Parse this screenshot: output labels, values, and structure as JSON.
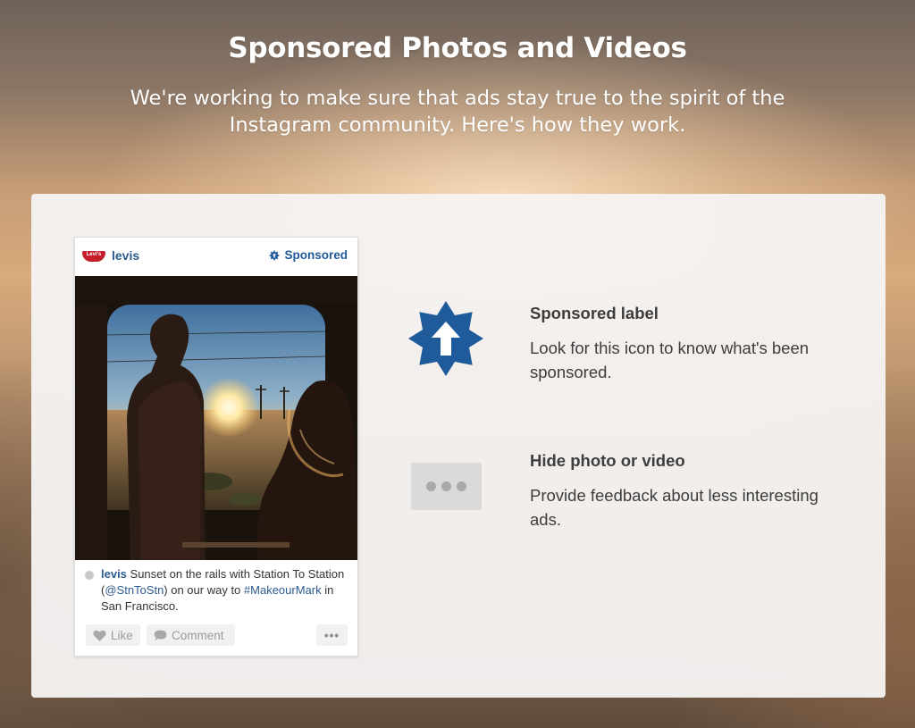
{
  "header": {
    "title": "Sponsored Photos and Videos",
    "subtitle": "We're working to make sure that ads stay true to the spirit of the Instagram community. Here's how they work."
  },
  "post": {
    "logo_text": "Levi's",
    "username": "levis",
    "sponsored_label": "Sponsored",
    "caption": {
      "user": "levis",
      "text_1": " Sunset on the rails with Station To Station (",
      "mention": "@StnToStn",
      "text_2": ") on our way to ",
      "hashtag": "#MakeourMark",
      "text_3": " in San Francisco."
    },
    "like_label": "Like",
    "comment_label": "Comment",
    "more_label": "•••"
  },
  "features": {
    "sponsored": {
      "title": "Sponsored label",
      "description": "Look for this icon to know what's been sponsored."
    },
    "hide": {
      "title": "Hide photo or video",
      "description": "Provide feedback about less interesting ads."
    }
  },
  "colors": {
    "brand_blue": "#1f5a9b",
    "link_blue": "#2b5b8f",
    "levis_red": "#c41e2a"
  }
}
